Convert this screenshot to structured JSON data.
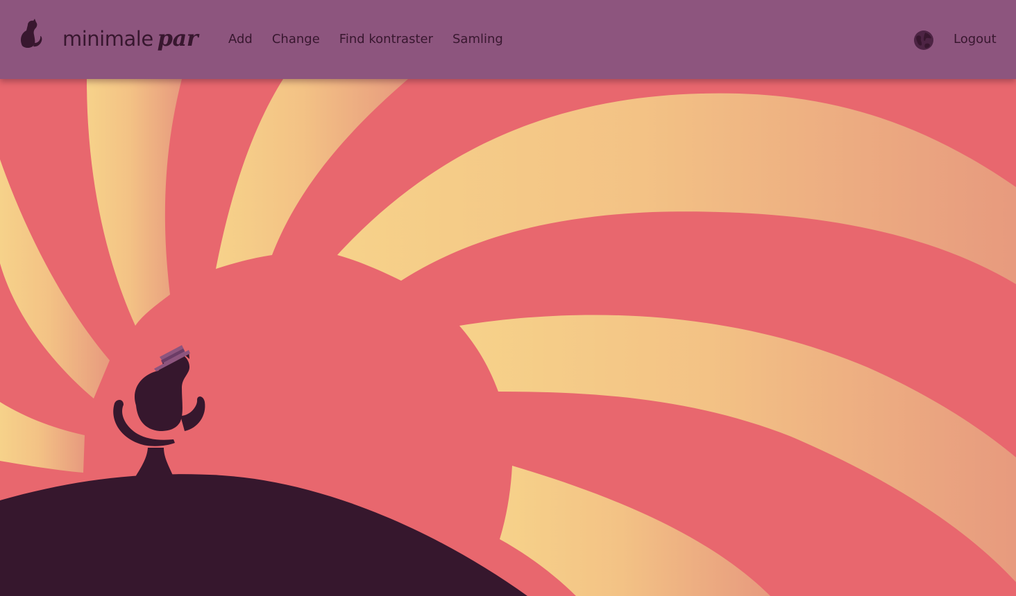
{
  "brand": {
    "name_part1": "minimale",
    "name_part2": "par",
    "icon": "cat-icon"
  },
  "nav": {
    "items": [
      {
        "label": "Add"
      },
      {
        "label": "Change"
      },
      {
        "label": "Find kontraster"
      },
      {
        "label": "Samling"
      }
    ]
  },
  "user_menu": {
    "language_icon": "globe-icon",
    "logout_label": "Logout"
  },
  "colors": {
    "navbar": "#8d557e",
    "text_dark": "#38172f",
    "background_red": "#e8676e",
    "ray_yellow": "#f6d28a",
    "ray_peach": "#e79a7e",
    "hill": "#36172d",
    "hat": "#8d557e"
  },
  "hero": {
    "illustration": "cat-on-hill-sunburst"
  }
}
